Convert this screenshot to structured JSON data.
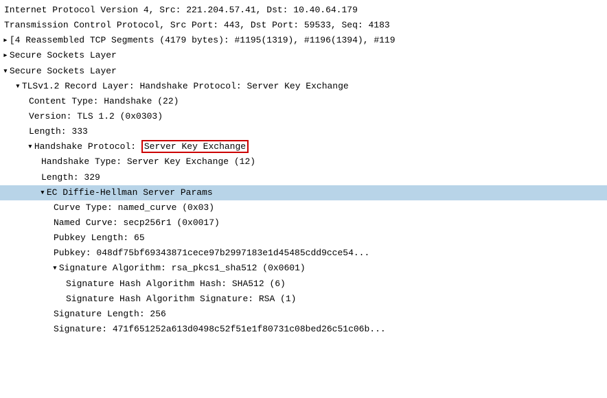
{
  "lines": [
    {
      "id": "ip-line",
      "indent": 0,
      "arrow": null,
      "text": "Internet Protocol Version 4, Src: 221.204.57.41, Dst: 10.40.64.179",
      "highlighted": false,
      "hasBox": false,
      "boxText": ""
    },
    {
      "id": "tcp-line",
      "indent": 0,
      "arrow": null,
      "text": "Transmission Control Protocol, Src Port: 443, Dst Port: 59533, Seq: 4183",
      "highlighted": false,
      "hasBox": false,
      "boxText": ""
    },
    {
      "id": "reassembled-line",
      "indent": 0,
      "arrow": "right",
      "text": "[4 Reassembled TCP Segments (4179 bytes): #1195(1319), #1196(1394), #119",
      "highlighted": false,
      "hasBox": false,
      "boxText": ""
    },
    {
      "id": "ssl1-line",
      "indent": 0,
      "arrow": "right",
      "text": "Secure Sockets Layer",
      "highlighted": false,
      "hasBox": false,
      "boxText": ""
    },
    {
      "id": "ssl2-line",
      "indent": 0,
      "arrow": "down",
      "text": "Secure Sockets Layer",
      "highlighted": false,
      "hasBox": false,
      "boxText": ""
    },
    {
      "id": "tls-record-line",
      "indent": 1,
      "arrow": "down",
      "text": "TLSv1.2 Record Layer: Handshake Protocol: Server Key Exchange",
      "highlighted": false,
      "hasBox": false,
      "boxText": ""
    },
    {
      "id": "content-type-line",
      "indent": 2,
      "arrow": null,
      "text": "Content Type: Handshake (22)",
      "highlighted": false,
      "hasBox": false,
      "boxText": ""
    },
    {
      "id": "version-line",
      "indent": 2,
      "arrow": null,
      "text": "Version: TLS 1.2 (0x0303)",
      "highlighted": false,
      "hasBox": false,
      "boxText": ""
    },
    {
      "id": "length-333-line",
      "indent": 2,
      "arrow": null,
      "text": "Length: 333",
      "highlighted": false,
      "hasBox": false,
      "boxText": ""
    },
    {
      "id": "handshake-protocol-line",
      "indent": 2,
      "arrow": "down",
      "textBefore": "Handshake Protocol: ",
      "hasBox": true,
      "boxText": "Server Key Exchange",
      "highlighted": false
    },
    {
      "id": "handshake-type-line",
      "indent": 3,
      "arrow": null,
      "text": "Handshake Type: Server Key Exchange (12)",
      "highlighted": false,
      "hasBox": false,
      "boxText": ""
    },
    {
      "id": "length-329-line",
      "indent": 3,
      "arrow": null,
      "text": "Length: 329",
      "highlighted": false,
      "hasBox": false,
      "boxText": ""
    },
    {
      "id": "ec-dh-line",
      "indent": 3,
      "arrow": "down",
      "text": "EC Diffie-Hellman Server Params",
      "highlighted": true,
      "hasBox": false,
      "boxText": ""
    },
    {
      "id": "curve-type-line",
      "indent": 4,
      "arrow": null,
      "text": "Curve Type: named_curve (0x03)",
      "highlighted": false,
      "hasBox": false,
      "boxText": ""
    },
    {
      "id": "named-curve-line",
      "indent": 4,
      "arrow": null,
      "text": "Named Curve: secp256r1 (0x0017)",
      "highlighted": false,
      "hasBox": false,
      "boxText": ""
    },
    {
      "id": "pubkey-length-line",
      "indent": 4,
      "arrow": null,
      "text": "Pubkey Length: 65",
      "highlighted": false,
      "hasBox": false,
      "boxText": ""
    },
    {
      "id": "pubkey-line",
      "indent": 4,
      "arrow": null,
      "text": "Pubkey: 048df75bf69343871cece97b2997183e1d45485cdd9cce54...",
      "highlighted": false,
      "hasBox": false,
      "boxText": ""
    },
    {
      "id": "sig-algo-line",
      "indent": 4,
      "arrow": "down",
      "text": "Signature Algorithm: rsa_pkcs1_sha512 (0x0601)",
      "highlighted": false,
      "hasBox": false,
      "boxText": ""
    },
    {
      "id": "sig-hash-hash-line",
      "indent": 5,
      "arrow": null,
      "text": "Signature Hash Algorithm Hash: SHA512 (6)",
      "highlighted": false,
      "hasBox": false,
      "boxText": ""
    },
    {
      "id": "sig-hash-sig-line",
      "indent": 5,
      "arrow": null,
      "text": "Signature Hash Algorithm Signature: RSA (1)",
      "highlighted": false,
      "hasBox": false,
      "boxText": ""
    },
    {
      "id": "sig-length-line",
      "indent": 4,
      "arrow": null,
      "text": "Signature Length: 256",
      "highlighted": false,
      "hasBox": false,
      "boxText": ""
    },
    {
      "id": "sig-value-line",
      "indent": 4,
      "arrow": null,
      "text": "Signature: 471f651252a613d0498c52f51e1f80731c08bed26c51c06b...",
      "highlighted": false,
      "hasBox": false,
      "boxText": ""
    }
  ],
  "indentSize": 18
}
